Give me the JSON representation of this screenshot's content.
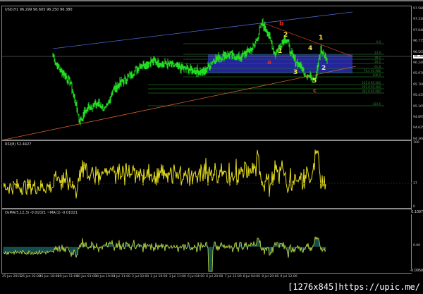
{
  "main": {
    "title": "USD,H1  96.299 96.605 96.250 96.380",
    "price_axis": [
      "97.580",
      "97.310",
      "97.040",
      "96.775",
      "96.505",
      "96.240",
      "95.970",
      "95.700",
      "95.435",
      "95.165",
      "94.895",
      "94.625",
      "94.360"
    ],
    "current_price": "96.380",
    "waves": {
      "b": "b",
      "a": "a",
      "c": "c",
      "w1": "1",
      "w2": "2",
      "w1b": "1",
      "w3": "3",
      "w4": "4",
      "w5": "5",
      "w1c": "1",
      "w2c": "2"
    },
    "fib_labels": [
      "0.0",
      "23.6",
      "38.2",
      "50.0",
      "61.8",
      "76.4  95.986",
      "100.0",
      "161.8  95.560",
      "261.8  95.400",
      "361.8  95.080",
      "423.6"
    ],
    "key_closes": [
      [
        0,
        96.45
      ],
      [
        5,
        96.19
      ],
      [
        25,
        95.75
      ],
      [
        38,
        94.8
      ],
      [
        50,
        95.14
      ],
      [
        65,
        95.23
      ],
      [
        75,
        95.06
      ],
      [
        85,
        95.58
      ],
      [
        110,
        95.93
      ],
      [
        125,
        96.19
      ],
      [
        140,
        96.27
      ],
      [
        165,
        96.19
      ],
      [
        185,
        96.1
      ],
      [
        215,
        96.01
      ],
      [
        225,
        96.27
      ],
      [
        245,
        96.45
      ],
      [
        265,
        96.36
      ],
      [
        285,
        96.62
      ],
      [
        297,
        97.23
      ],
      [
        305,
        96.97
      ],
      [
        315,
        96.45
      ],
      [
        330,
        96.88
      ],
      [
        340,
        96.36
      ],
      [
        350,
        96.19
      ],
      [
        360,
        95.93
      ],
      [
        372,
        95.87
      ],
      [
        380,
        96.54
      ],
      [
        390,
        96.27
      ]
    ],
    "price_range": [
      94.36,
      97.58
    ],
    "colors": {
      "bull": "#22dd22",
      "bear": "#22dd22",
      "zone": "#2a2ab8",
      "fib": "#1f6b1f",
      "upper_trend": "#4a6ad0",
      "lower_trend": "#d0602a",
      "b_line": "#c04020"
    }
  },
  "rsi": {
    "title": "RSI(8) 52.4427",
    "axis": [
      "100",
      "37",
      "0"
    ]
  },
  "osma": {
    "title": "OsMA(5,12,3) -0.01021   ~MA(1) -0.01021",
    "axis": [
      "0.1097",
      "0.00",
      "-0.0950"
    ]
  },
  "time_axis": [
    "25 Jun 2015",
    "26 Jun 02:00",
    "26 Jun 18:00",
    "29 Jun 11:00",
    "30 Jun 03:00",
    "30 Jun 19:00",
    "1 Jul 11:00",
    "2 Jul 03:00",
    "2 Jul 19:00",
    "3 Jul 11:00",
    "6 Jul 04:00",
    "6 Jul 20:00",
    "7 Jul 12:00",
    "8 Jul 04:00",
    "8 Jul 20:00",
    "9 Jul 12:00"
  ],
  "watermark": "[1276x845]https://upic.me/"
}
